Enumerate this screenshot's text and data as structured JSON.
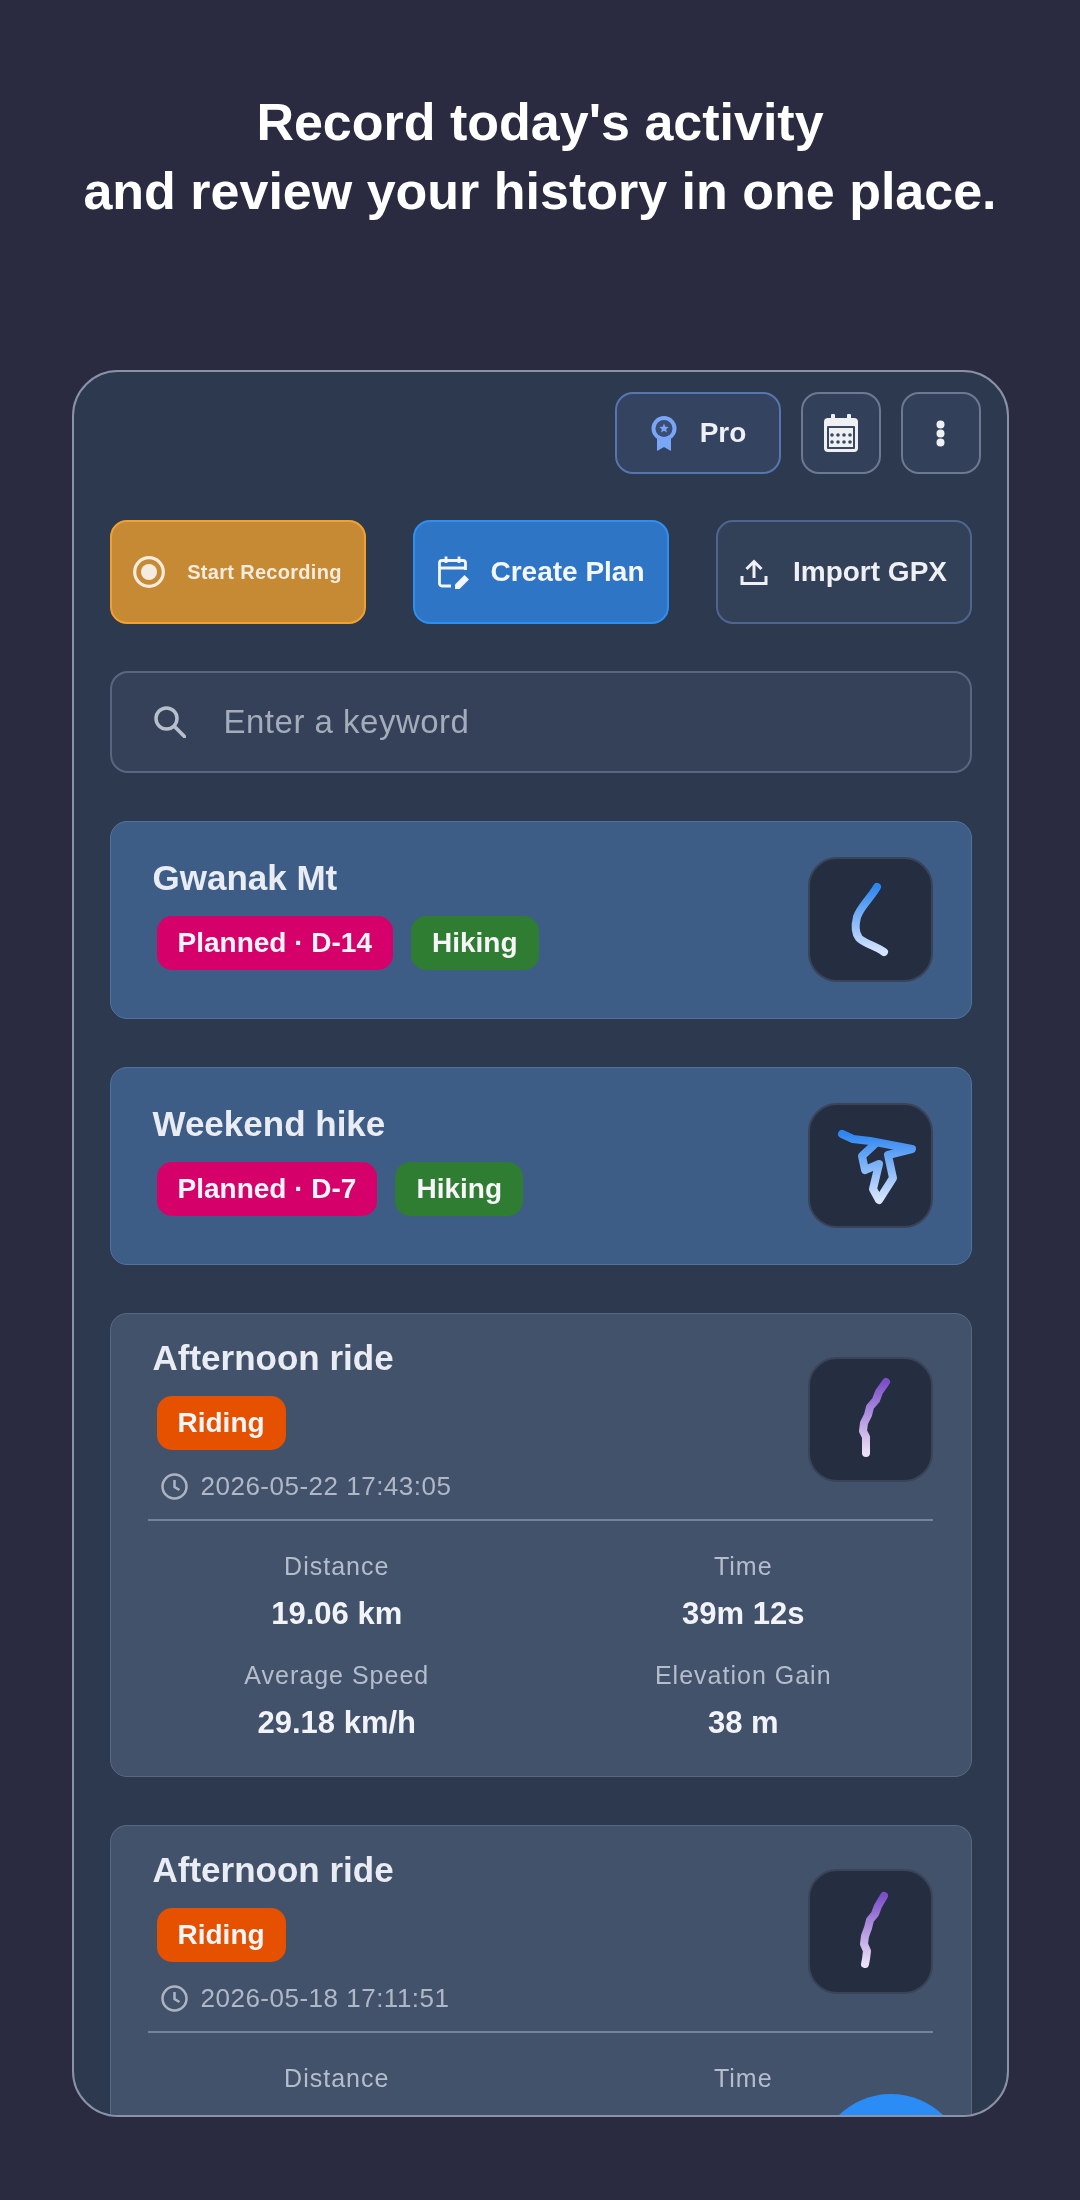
{
  "headline": {
    "lines": [
      "Record today's activity",
      "and review your history in one place."
    ]
  },
  "toolbar": {
    "buttons": [
      {
        "kind": "pro",
        "label": "Pro"
      },
      {
        "kind": "calendar"
      },
      {
        "kind": "more"
      }
    ]
  },
  "actions": [
    {
      "kind": "record",
      "label": "Start Recording"
    },
    {
      "kind": "plan",
      "label": "Create Plan"
    },
    {
      "kind": "import",
      "label": "Import GPX"
    }
  ],
  "search": {
    "placeholder": "Enter a keyword"
  },
  "cards": [
    {
      "kind": "planned",
      "title": "Gwanak Mt",
      "tags": [
        {
          "label": "Planned · D-14",
          "color": "#d6006b"
        },
        {
          "label": "Hiking",
          "color": "#2e7d32"
        }
      ]
    },
    {
      "kind": "planned",
      "title": "Weekend hike",
      "tags": [
        {
          "label": "Planned · D-7",
          "color": "#d6006b"
        },
        {
          "label": "Hiking",
          "color": "#2e7d32"
        }
      ]
    },
    {
      "kind": "activity",
      "title": "Afternoon ride",
      "tags": [
        {
          "label": "Riding",
          "color": "#e65100"
        }
      ],
      "recorded_at": "2026-05-22 17:43:05",
      "stats": [
        {
          "label": "Distance",
          "value": "19.06 km"
        },
        {
          "label": "Time",
          "value": "39m 12s"
        },
        {
          "label": "Average Speed",
          "value": "29.18 km/h"
        },
        {
          "label": "Elevation Gain",
          "value": "38 m"
        }
      ]
    },
    {
      "kind": "activity",
      "title": "Afternoon ride",
      "tags": [
        {
          "label": "Riding",
          "color": "#e65100"
        }
      ],
      "recorded_at": "2026-05-18 17:11:51",
      "stats": [
        {
          "label": "Distance"
        },
        {
          "label": "Time"
        }
      ]
    }
  ]
}
